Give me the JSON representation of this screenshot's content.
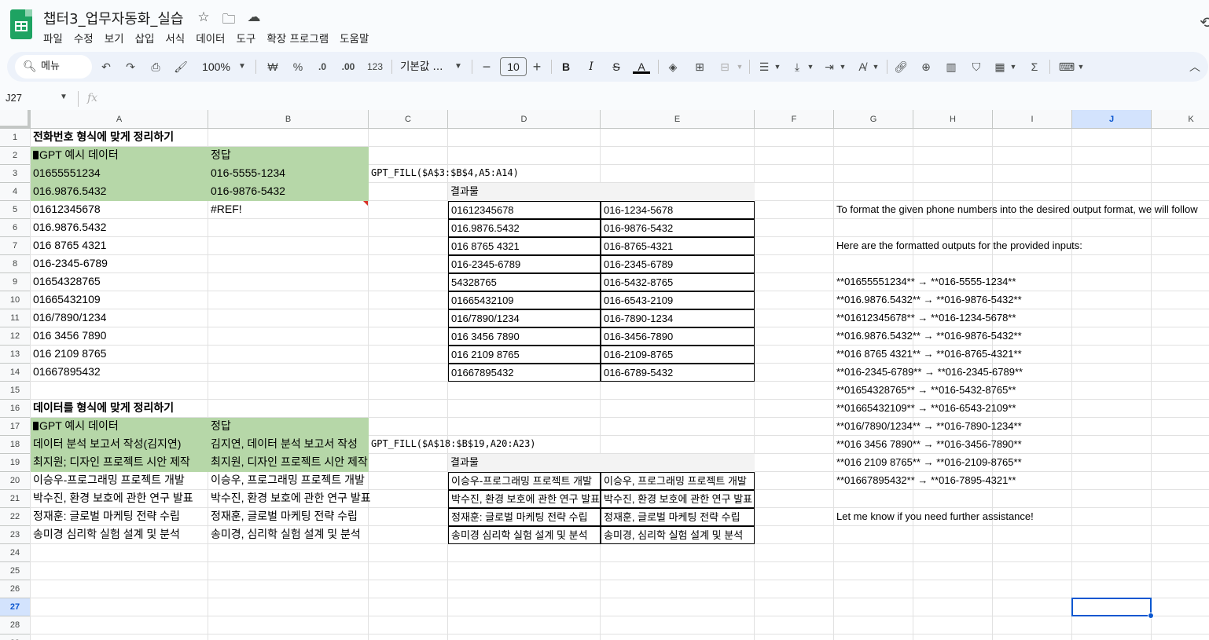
{
  "doc": {
    "title": "챕터3_업무자동화_실습",
    "menu": [
      "파일",
      "수정",
      "보기",
      "삽입",
      "서식",
      "데이터",
      "도구",
      "확장 프로그램",
      "도움말"
    ]
  },
  "toolbar": {
    "search_label": "메뉴",
    "zoom": "100%",
    "currency": "₩",
    "percent": "%",
    "dec_decrease": ".0",
    "dec_increase": ".00",
    "num_format": "123",
    "font": "기본값 ...",
    "font_size": "10",
    "minus": "−",
    "plus": "+"
  },
  "formula_bar": {
    "cell_ref": "J27",
    "fx_label": "fx",
    "formula": ""
  },
  "columns": [
    "A",
    "B",
    "C",
    "D",
    "E",
    "F",
    "G",
    "H",
    "I",
    "J",
    "K"
  ],
  "selected_column": "J",
  "selected_row": 27,
  "rows": [
    1,
    2,
    3,
    4,
    5,
    6,
    7,
    8,
    9,
    10,
    11,
    12,
    13,
    14,
    15,
    16,
    17,
    18,
    19,
    20,
    21,
    22,
    23,
    24,
    25,
    26,
    27,
    28,
    29
  ],
  "sheet": {
    "a1": "전화번호 형식에 맞게 정리하기",
    "a2": "GPT 예시 데이터",
    "b2": "정답",
    "a3": "01655551234",
    "b3": "016-5555-1234",
    "c3": "GPT_FILL($A$3:$B$4,A5:A14)",
    "a4": "016.9876.5432",
    "b4": "016-9876-5432",
    "d4": "결과물",
    "a5_a14": [
      "01612345678",
      "016.9876.5432",
      "016 8765 4321",
      "016-2345-6789",
      "01654328765",
      "01665432109",
      "016/7890/1234",
      "016 3456 7890",
      "016 2109 8765",
      "01667895432"
    ],
    "b5": "#REF!",
    "d5_d14": [
      "01612345678",
      "016.9876.5432",
      "016 8765 4321",
      "016-2345-6789",
      "54328765",
      "01665432109",
      "016/7890/1234",
      "016 3456 7890",
      "016 2109 8765",
      "01667895432"
    ],
    "e5_e14": [
      "016-1234-5678",
      "016-9876-5432",
      "016-8765-4321",
      "016-2345-6789",
      "016-5432-8765",
      "016-6543-2109",
      "016-7890-1234",
      "016-3456-7890",
      "016-2109-8765",
      "016-6789-5432"
    ],
    "g_texts": {
      "g5": "To format the given phone numbers into the desired output format, we will follow",
      "g7": "Here are the formatted outputs for the provided inputs:",
      "g9_g20": [
        "**01655551234** → **016-5555-1234**",
        "**016.9876.5432** → **016-9876-5432**",
        "**01612345678** → **016-1234-5678**",
        "**016.9876.5432** → **016-9876-5432**",
        "**016 8765 4321** → **016-8765-4321**",
        "**016-2345-6789** → **016-2345-6789**",
        "**01654328765** → **016-5432-8765**",
        "**01665432109** → **016-6543-2109**",
        "**016/7890/1234** → **016-7890-1234**",
        "**016 3456 7890** → **016-3456-7890**",
        "**016 2109 8765** → **016-2109-8765**",
        "**01667895432** → **016-7895-4321**"
      ],
      "g22": "Let me know if you need further assistance!"
    },
    "a16": "데이터를 형식에 맞게 정리하기",
    "a17": "GPT 예시 데이터",
    "b17": "정답",
    "a18": "데이터 분석 보고서 작성(김지연)",
    "b18": "김지연, 데이터 분석 보고서 작성",
    "c18": "GPT_FILL($A$18:$B$19,A20:A23)",
    "a19": "최지원; 디자인 프로젝트 시안 제작",
    "b19": "최지원, 디자인 프로젝트 시안 제작",
    "d19": "결과물",
    "a20_a23": [
      "이승우-프로그래밍 프로젝트 개발",
      "박수진, 환경 보호에 관한 연구 발표",
      "정재훈: 글로벌 마케팅 전략 수립",
      "송미경 심리학 실험 설계 및 분석"
    ],
    "b20_b23": [
      "이승우, 프로그래밍 프로젝트 개발",
      "박수진, 환경 보호에 관한 연구 발표",
      "정재훈, 글로벌 마케팅 전략 수립",
      "송미경, 심리학 실험 설계 및 분석"
    ],
    "d20_d23": [
      "이승우-프로그래밍 프로젝트 개발",
      "박수진, 환경 보호에 관한 연구 발표",
      "정재훈: 글로벌 마케팅 전략 수립",
      "송미경 심리학 실험 설계 및 분석"
    ],
    "e20_e23": [
      "이승우, 프로그래밍 프로젝트 개발",
      "박수진, 환경 보호에 관한 연구 발표",
      "정재훈, 글로벌 마케팅 전략 수립",
      "송미경, 심리학 실험 설계 및 분석"
    ]
  },
  "colors": {
    "header_green": "#b6d7a8",
    "result_gray": "#f3f3f3",
    "selection_blue": "#0b57d0",
    "sheets_green": "#1ea362"
  }
}
